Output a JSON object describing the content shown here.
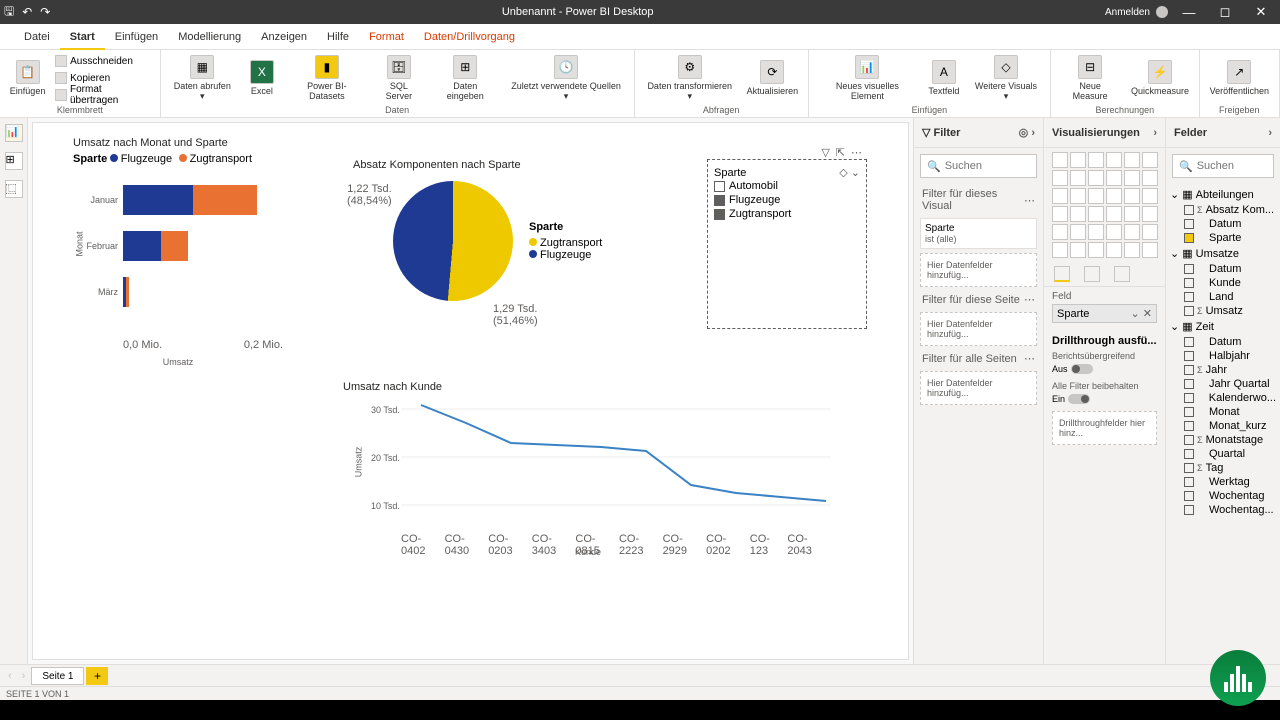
{
  "titlebar": {
    "title": "Unbenannt - Power BI Desktop",
    "signin": "Anmelden"
  },
  "tabs": {
    "file": "Datei",
    "home": "Start",
    "insert": "Einfügen",
    "modeling": "Modellierung",
    "view": "Anzeigen",
    "help": "Hilfe",
    "format": "Format",
    "datadrill": "Daten/Drillvorgang"
  },
  "ribbon": {
    "clipboard": {
      "paste": "Einfügen",
      "cut": "Ausschneiden",
      "copy": "Kopieren",
      "format_painter": "Format übertragen",
      "group": "Klemmbrett"
    },
    "data": {
      "get_data": "Daten abrufen ▾",
      "excel": "Excel",
      "pbi": "Power BI-Datasets",
      "sql": "SQL Server",
      "enter": "Daten eingeben",
      "recent": "Zuletzt verwendete Quellen ▾",
      "group": "Daten"
    },
    "queries": {
      "transform": "Daten transformieren ▾",
      "refresh": "Aktualisieren",
      "group": "Abfragen"
    },
    "insert": {
      "newvis": "Neues visuelles Element",
      "text": "Textfeld",
      "more": "Weitere Visuals ▾",
      "group": "Einfügen"
    },
    "calc": {
      "measure": "Neue Measure",
      "quick": "Quickmeasure",
      "group": "Berechnungen"
    },
    "share": {
      "publish": "Veröffentlichen",
      "group": "Freigeben"
    }
  },
  "bar_chart": {
    "title": "Umsatz nach Monat und Sparte",
    "legend_label": "Sparte",
    "legend": [
      "Flugzeuge",
      "Zugtransport"
    ],
    "ylabel": "Monat",
    "xlabel": "Umsatz",
    "xticks": [
      "0,0 Mio.",
      "0,2 Mio."
    ]
  },
  "pie_chart": {
    "title": "Absatz Komponenten nach Sparte",
    "legend_title": "Sparte",
    "legend": [
      "Zugtransport",
      "Flugzeuge"
    ],
    "label1a": "1,22 Tsd.",
    "label1b": "(48,54%)",
    "label2a": "1,29 Tsd.",
    "label2b": "(51,46%)"
  },
  "slicer": {
    "title": "Sparte",
    "items": [
      "Automobil",
      "Flugzeuge",
      "Zugtransport"
    ]
  },
  "line_chart": {
    "title": "Umsatz nach Kunde",
    "ylabel": "Umsatz",
    "xlabel": "Kunde",
    "yticks": [
      "30 Tsd.",
      "20 Tsd.",
      "10 Tsd."
    ],
    "xticks": [
      "CO-0402",
      "CO-0430",
      "CO-0203",
      "CO-3403",
      "CO-0815",
      "CO-2223",
      "CO-2929",
      "CO-0202",
      "CO-123",
      "CO-2043"
    ]
  },
  "filter_pane": {
    "title": "Filter",
    "search": "Suchen",
    "visual": "Filter für dieses Visual",
    "card_field": "Sparte",
    "card_value": "ist (alle)",
    "add": "Hier Datenfelder hinzufüg...",
    "page": "Filter für diese Seite",
    "all": "Filter für alle Seiten"
  },
  "viz_pane": {
    "title": "Visualisierungen",
    "field_label": "Feld",
    "field_value": "Sparte",
    "drill_title": "Drillthrough ausfü...",
    "cross": "Berichtsübergreifend",
    "off": "Aus",
    "keep": "Alle Filter beibehalten",
    "on": "Ein",
    "drill_add": "Drillthroughfelder hier hinz..."
  },
  "fields_pane": {
    "title": "Felder",
    "search": "Suchen",
    "tables": {
      "Abteilungen": [
        {
          "n": "Absatz Kom...",
          "s": true
        },
        {
          "n": "Datum"
        },
        {
          "n": "Sparte",
          "c": true
        }
      ],
      "Umsatze": [
        {
          "n": "Datum"
        },
        {
          "n": "Kunde"
        },
        {
          "n": "Land"
        },
        {
          "n": "Umsatz",
          "s": true
        }
      ],
      "Zeit": [
        {
          "n": "Datum"
        },
        {
          "n": "Halbjahr"
        },
        {
          "n": "Jahr",
          "s": true
        },
        {
          "n": "Jahr Quartal"
        },
        {
          "n": "Kalenderwo..."
        },
        {
          "n": "Monat"
        },
        {
          "n": "Monat_kurz"
        },
        {
          "n": "Monatstage",
          "s": true
        },
        {
          "n": "Quartal"
        },
        {
          "n": "Tag",
          "s": true
        },
        {
          "n": "Werktag"
        },
        {
          "n": "Wochentag"
        },
        {
          "n": "Wochentag..."
        }
      ]
    }
  },
  "footer": {
    "page": "Seite 1",
    "status": "SEITE 1 VON 1"
  },
  "chart_data": [
    {
      "type": "bar",
      "orientation": "horizontal",
      "stacked": true,
      "title": "Umsatz nach Monat und Sparte",
      "ylabel": "Monat",
      "xlabel": "Umsatz",
      "categories": [
        "Januar",
        "Februar",
        "März"
      ],
      "series": [
        {
          "name": "Flugzeuge",
          "values": [
            0.13,
            0.07,
            0.005
          ],
          "color": "#1f3a93"
        },
        {
          "name": "Zugtransport",
          "values": [
            0.12,
            0.05,
            0.005
          ],
          "color": "#e97132"
        }
      ],
      "xlim": [
        0,
        0.25
      ],
      "xunit": "Mio."
    },
    {
      "type": "pie",
      "title": "Absatz Komponenten nach Sparte",
      "series": [
        {
          "name": "Zugtransport",
          "value": 1290,
          "pct": 51.46,
          "color": "#eec900"
        },
        {
          "name": "Flugzeuge",
          "value": 1220,
          "pct": 48.54,
          "color": "#1f3a93"
        }
      ]
    },
    {
      "type": "line",
      "title": "Umsatz nach Kunde",
      "ylabel": "Umsatz",
      "xlabel": "Kunde",
      "x": [
        "CO-0402",
        "CO-0430",
        "CO-0203",
        "CO-3403",
        "CO-0815",
        "CO-2223",
        "CO-2929",
        "CO-0202",
        "CO-123",
        "CO-2043"
      ],
      "y": [
        31,
        27,
        22,
        21.5,
        21,
        20,
        13,
        11,
        10,
        9
      ],
      "yunit": "Tsd.",
      "ylim": [
        5,
        32
      ],
      "color": "#3a82c4"
    }
  ]
}
